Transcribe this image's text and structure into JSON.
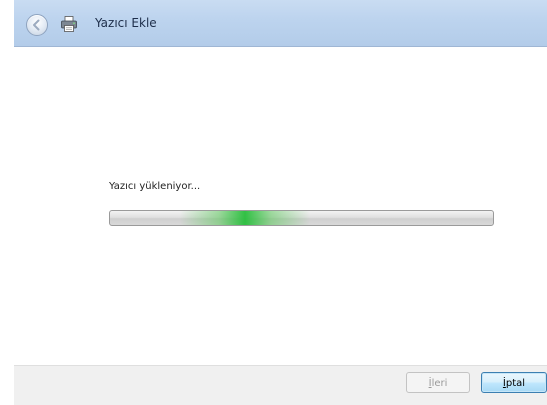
{
  "window": {
    "title": "Yazıcı Ekle",
    "icons": {
      "back": "back-arrow-icon",
      "app": "printer-icon"
    }
  },
  "content": {
    "status_text": "Yazıcı yükleniyor...",
    "progress": {
      "style": "indeterminate-marquee",
      "glow_color": "#3cc04a"
    }
  },
  "footer": {
    "next_label": "İleri",
    "cancel_label": "İptal"
  },
  "colors": {
    "titlebar": "#bcd3ee",
    "footer": "#f0f0f0",
    "focus_border": "#3c7fb1"
  }
}
